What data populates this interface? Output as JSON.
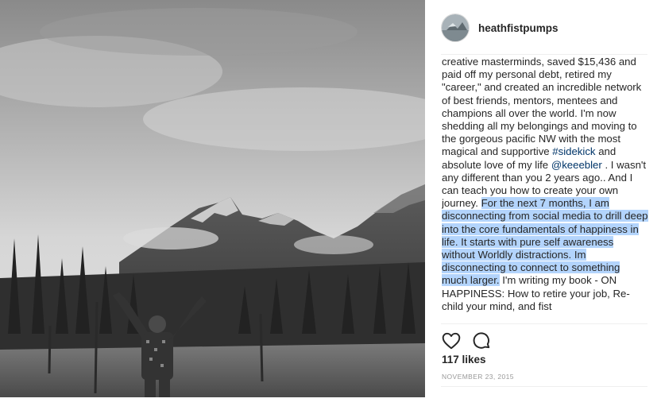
{
  "post": {
    "username": "heathfistpumps",
    "caption": {
      "part1": "creative masterminds, saved $15,436 and paid off my personal debt, retired my \"career,\" and created an incredible network of best friends, mentors, mentees and champions all over the world. I'm now shedding all my belongings and moving to the gorgeous pacific NW with the most magical and supportive ",
      "hashtag": "#sidekick",
      "part2": " and absolute love of my life ",
      "mention": "@keeebler",
      "part3": " . I wasn't any different than you 2 years ago.. And I can teach you how to create your own journey. ",
      "highlighted": "For the next 7 months, I am disconnecting from social media to drill deep into the core fundamentals of happiness in life. It starts with pure self awareness without Worldly distractions. Im disconnecting to connect to something much larger.",
      "part4": " I'm writing my book - ON HAPPINESS: How to retire your job, Re-child your mind, and fist"
    },
    "likes": "117 likes",
    "date": "NOVEMBER 23, 2015",
    "icons": {
      "like": "heart-icon",
      "comment": "comment-icon"
    },
    "colors": {
      "highlight": "#b3d4fc",
      "link": "#003569",
      "date": "#999999"
    }
  }
}
